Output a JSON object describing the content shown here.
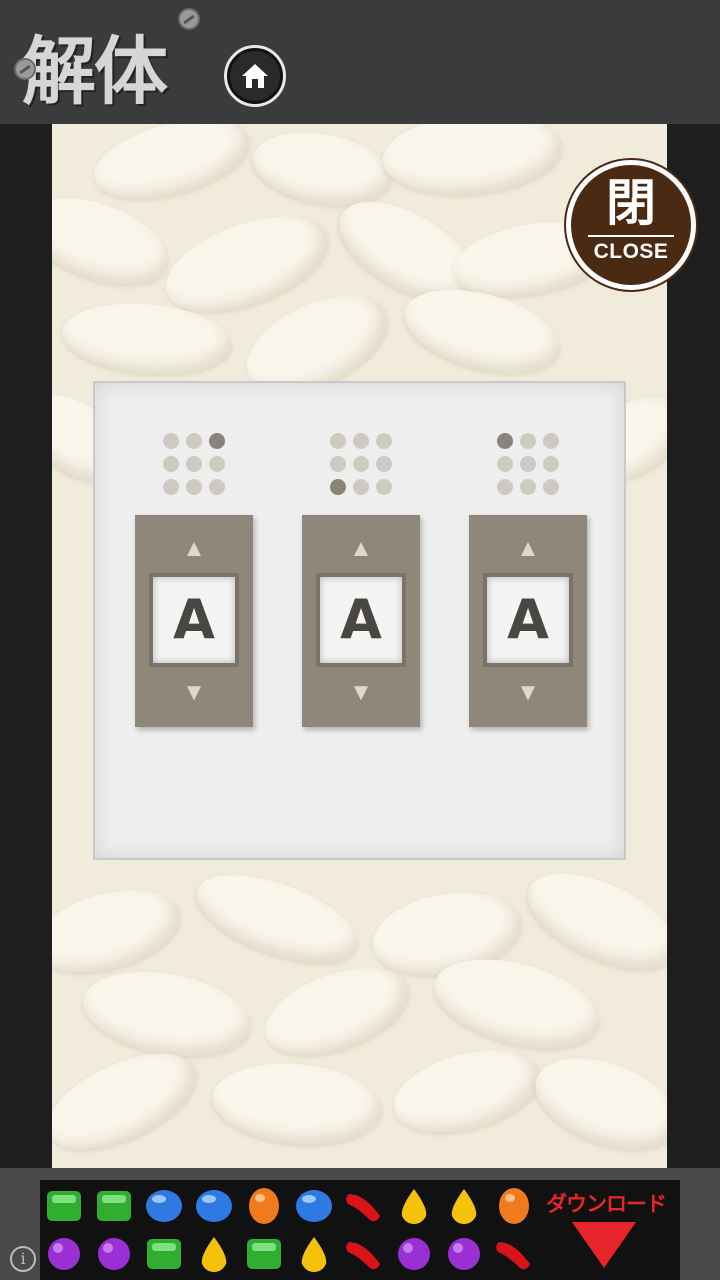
{
  "header": {
    "title": "解体",
    "home_icon": "home-icon"
  },
  "close_button": {
    "kanji": "閉",
    "label": "CLOSE",
    "color": "#4b2a14"
  },
  "dials": [
    {
      "letter": "A",
      "active_dot": 2
    },
    {
      "letter": "A",
      "active_dot": 6
    },
    {
      "letter": "A",
      "active_dot": 0
    }
  ],
  "ad": {
    "download_label": "ダウンロード",
    "info_icon": "info-icon",
    "accent": "#e8232a"
  }
}
